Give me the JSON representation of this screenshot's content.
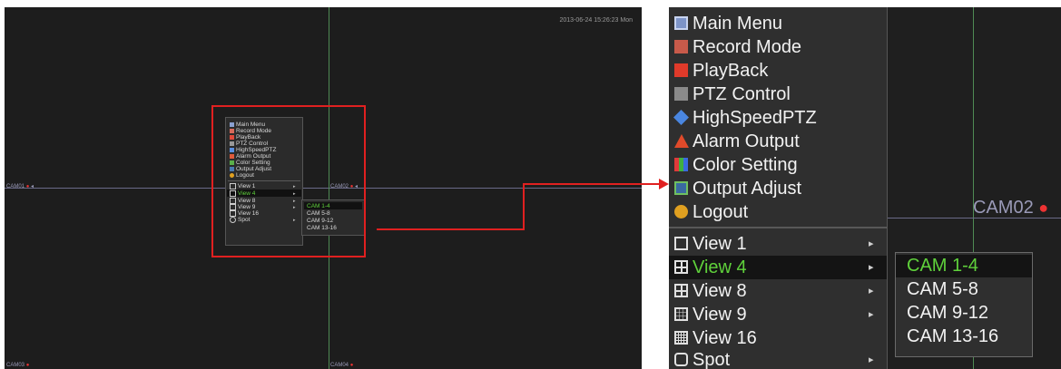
{
  "overview": {
    "timestamp": "2013-06-24 15:26:23 Mon",
    "cameras": {
      "cam01": "CAM01",
      "cam02": "CAM02",
      "cam03": "CAM03",
      "cam04": "CAM04"
    },
    "record_dot": "●",
    "arrow": "◂"
  },
  "menu": {
    "items": [
      {
        "label": "Main Menu",
        "icon": "main-menu-icon"
      },
      {
        "label": "Record Mode",
        "icon": "record-mode-icon"
      },
      {
        "label": "PlayBack",
        "icon": "playback-icon"
      },
      {
        "label": "PTZ Control",
        "icon": "ptz-control-icon"
      },
      {
        "label": "HighSpeedPTZ",
        "icon": "highspeed-ptz-icon"
      },
      {
        "label": "Alarm Output",
        "icon": "alarm-output-icon"
      },
      {
        "label": "Color Setting",
        "icon": "color-setting-icon"
      },
      {
        "label": "Output Adjust",
        "icon": "output-adjust-icon"
      },
      {
        "label": "Logout",
        "icon": "logout-icon"
      }
    ],
    "views": [
      {
        "label": "View 1",
        "icon": "view1-icon",
        "has_sub": true
      },
      {
        "label": "View 4",
        "icon": "view4-icon",
        "has_sub": true,
        "selected": true
      },
      {
        "label": "View 8",
        "icon": "view8-icon",
        "has_sub": true
      },
      {
        "label": "View 9",
        "icon": "view9-icon",
        "has_sub": true
      },
      {
        "label": "View 16",
        "icon": "view16-icon",
        "has_sub": false
      },
      {
        "label": "Spot",
        "icon": "spot-icon",
        "has_sub": true
      }
    ],
    "submenu_arrow": "▸"
  },
  "submenu": {
    "items": [
      "CAM 1-4",
      "CAM 5-8",
      "CAM 9-12",
      "CAM 13-16"
    ],
    "selected_index": 0
  },
  "colors": {
    "highlight_text": "#5fd13b",
    "callout_red": "#e02020"
  }
}
